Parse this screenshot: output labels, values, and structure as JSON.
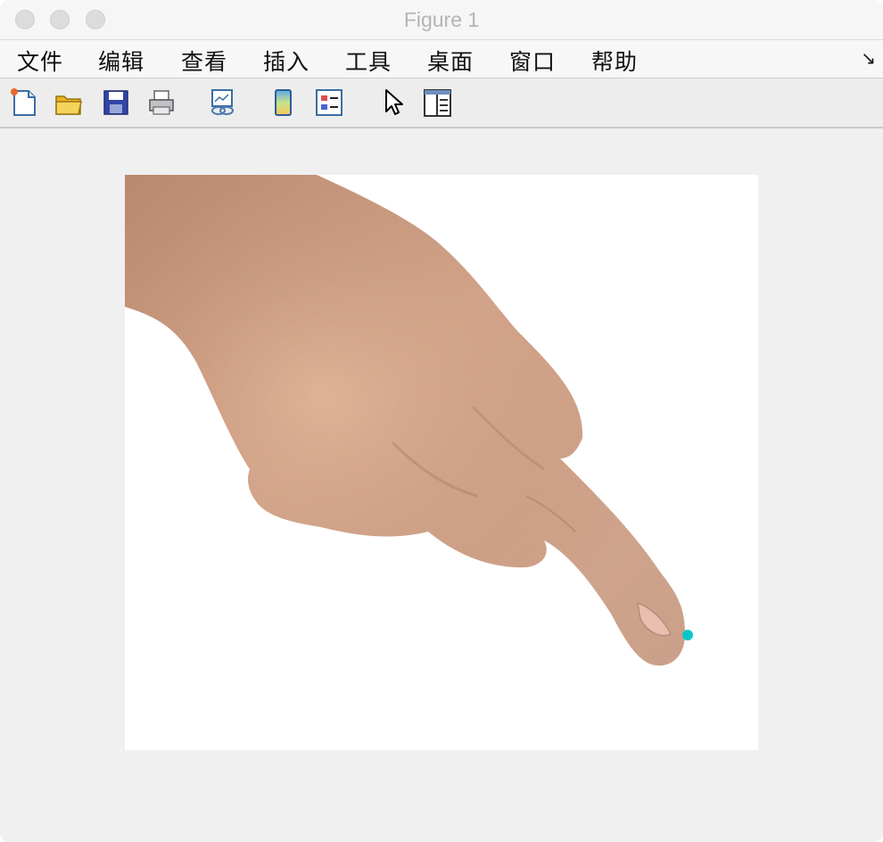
{
  "window": {
    "title": "Figure 1"
  },
  "menubar": {
    "items": [
      {
        "label": "文件"
      },
      {
        "label": "编辑"
      },
      {
        "label": "查看"
      },
      {
        "label": "插入"
      },
      {
        "label": "工具"
      },
      {
        "label": "桌面"
      },
      {
        "label": "窗口"
      },
      {
        "label": "帮助"
      }
    ],
    "dock_arrow": "↘"
  },
  "toolbar": {
    "tools": [
      {
        "icon": "new-figure-icon"
      },
      {
        "icon": "open-folder-icon"
      },
      {
        "icon": "save-icon"
      },
      {
        "icon": "print-icon"
      },
      {
        "icon": "link-plot-icon"
      },
      {
        "icon": "insert-colorbar-icon"
      },
      {
        "icon": "insert-legend-icon"
      },
      {
        "icon": "edit-plot-pointer-icon"
      },
      {
        "icon": "property-inspector-icon"
      }
    ]
  },
  "figure": {
    "image_subject": "hand pointing index finger downward",
    "marker_color": "#0ac7c7"
  }
}
